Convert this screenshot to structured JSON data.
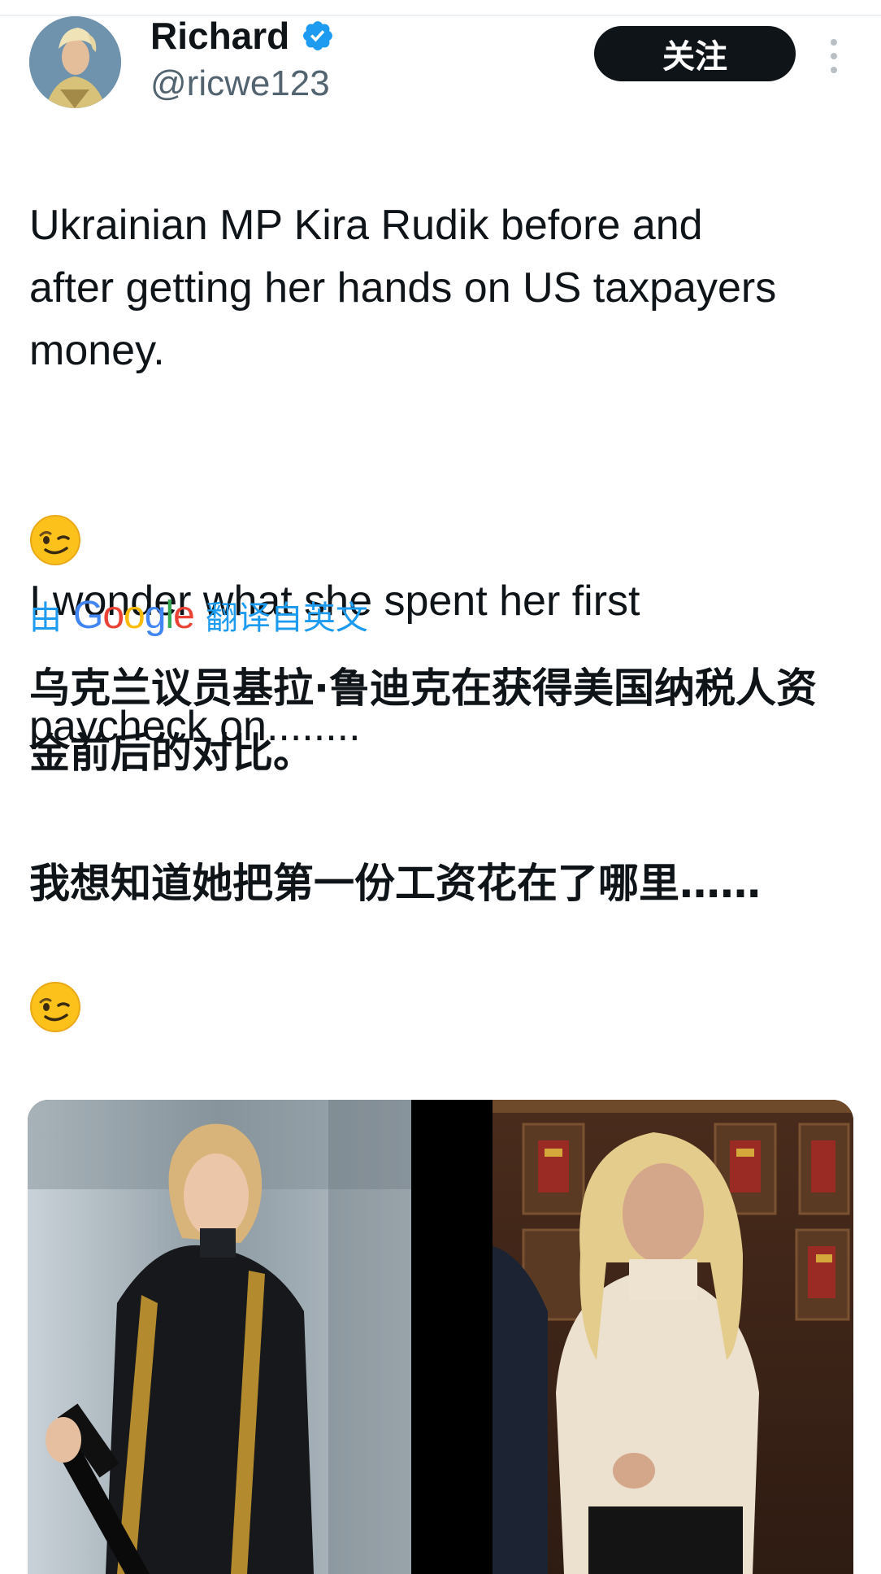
{
  "user": {
    "display_name": "Richard",
    "handle": "@ricwe123",
    "verified_icon": "verified-badge-icon",
    "avatar_icon": "avatar"
  },
  "actions": {
    "follow_label": "关注",
    "more_icon": "more-vertical-icon"
  },
  "tweet": {
    "text_en_p1": "Ukrainian MP Kira Rudik before and after getting her hands on US taxpayers money.",
    "text_en_p2_line1": "I wonder what she spent her first",
    "text_en_p2_line2": "paycheck on........",
    "emoji_icon": "winking-face-icon"
  },
  "translation": {
    "prefix": "由",
    "provider": "Google",
    "suffix": "翻译自英文",
    "text_zh_p1": "乌克兰议员基拉·鲁迪克在获得美国纳税人资金前后的对比。",
    "text_zh_p2": "我想知道她把第一份工资花在了哪里……"
  },
  "colors": {
    "text": "#0f1419",
    "secondary": "#536471",
    "link": "#1d9bf0",
    "follow_bg": "#0f1419",
    "verified": "#1d9bf0"
  }
}
